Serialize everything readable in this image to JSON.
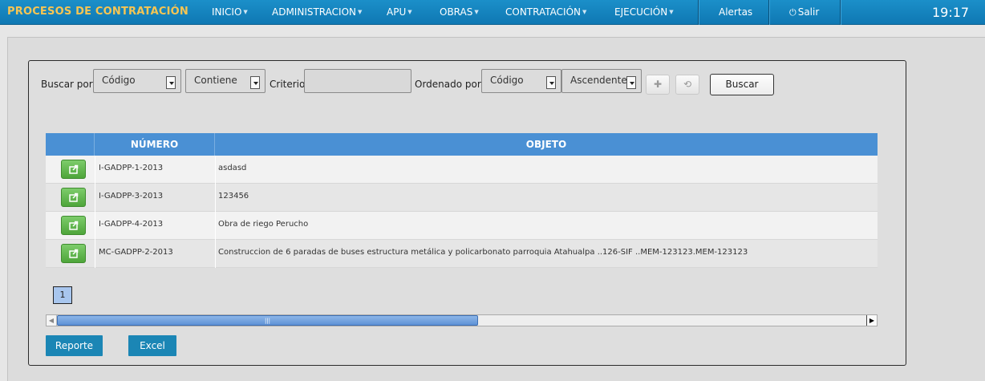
{
  "navbar": {
    "app_title": "PROCESOS DE CONTRATACIÓN",
    "menu": [
      {
        "label": "INICIO"
      },
      {
        "label": "ADMINISTRACION"
      },
      {
        "label": "APU"
      },
      {
        "label": "OBRAS"
      },
      {
        "label": "CONTRATACIÓN"
      },
      {
        "label": "EJECUCIÓN"
      }
    ],
    "alerts_label": "Alertas",
    "logout_label": "Salir",
    "clock": "19:17"
  },
  "search": {
    "search_by_label": "Buscar por:",
    "field_value": "Código",
    "operator_value": "Contiene",
    "criteria_label": "Criterio:",
    "criteria_value": "",
    "order_by_label": "Ordenado por:",
    "order_field_value": "Código",
    "order_direction_value": "Ascendente",
    "search_button_label": "Buscar"
  },
  "table": {
    "headers": [
      "",
      "NÚMERO",
      "OBJETO"
    ],
    "rows": [
      {
        "numero": "I-GADPP-1-2013",
        "objeto": "asdasd"
      },
      {
        "numero": "I-GADPP-3-2013",
        "objeto": "123456"
      },
      {
        "numero": "I-GADPP-4-2013",
        "objeto": "Obra de riego Perucho"
      },
      {
        "numero": "MC-GADPP-2-2013",
        "objeto": "Construccion de 6 paradas de buses estructura metálica y policarbonato parroquia Atahualpa ..126-SIF ..MEM-123123.MEM-123123"
      }
    ]
  },
  "pagination": {
    "current_page": "1"
  },
  "scrollbar": {
    "position_fraction": 0.0,
    "visible_fraction": 0.52
  },
  "actions": {
    "report_label": "Reporte",
    "excel_label": "Excel"
  },
  "colors": {
    "navbar": "#1b8fc9",
    "title": "#f6c553",
    "table_header": "#4a90d4",
    "row_button": "#5cb85c",
    "bottom_button": "#1b86b5"
  }
}
